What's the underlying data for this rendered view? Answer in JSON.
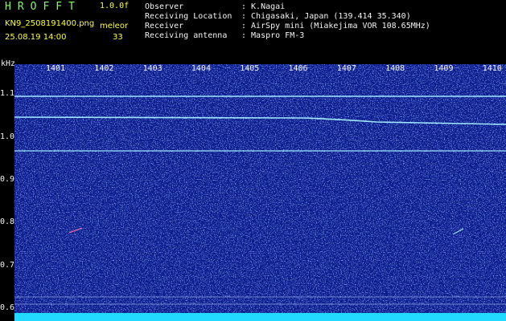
{
  "header": {
    "logo": "HROFFT",
    "version": "1.0.0f",
    "filename": "KN9_2508191400.png",
    "meteor_label": "meleor",
    "meteor_count": "33",
    "datetime": "25.08.19 14:00",
    "info": [
      {
        "label": "Observer",
        "value": ": K.Nagai"
      },
      {
        "label": "Receiving Location",
        "value": ": Chigasaki, Japan (139.414 35.340)"
      },
      {
        "label": "Receiver",
        "value": ": AirSpy mini (Miakejima VOR 108.65MHz)"
      },
      {
        "label": "Receiving antenna",
        "value": ": Maspro FM-3"
      }
    ]
  },
  "plot": {
    "y_unit": "kHz",
    "y_ticks": [
      "1.1",
      "1.0",
      "0.9",
      "0.8",
      "0.7",
      "0.6"
    ],
    "x_ticks": [
      "1401",
      "1402",
      "1403",
      "1404",
      "1405",
      "1406",
      "1407",
      "1408",
      "1409",
      "1410"
    ],
    "ylim": [
      0.57,
      1.17
    ],
    "colors": {
      "background": "#0a1a8c",
      "noise": "#4a7dff",
      "trace": "#9fe8ff",
      "bottom_band": "#22d9ff"
    }
  }
}
